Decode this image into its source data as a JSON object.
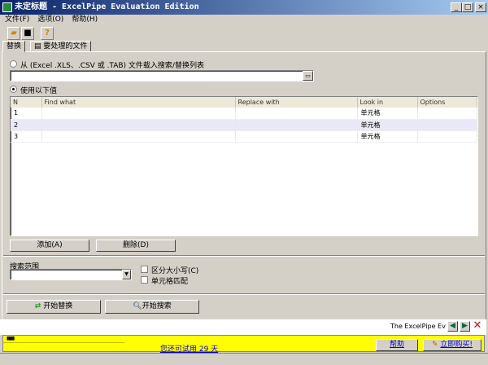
{
  "window": {
    "title": "未定标题 - ExcelPipe Evaluation Edition"
  },
  "menu": [
    "文件(F)",
    "选项(O)",
    "帮助(H)"
  ],
  "toolbar": {
    "icons": [
      "open-folder-icon",
      "save-icon",
      "help-icon"
    ]
  },
  "tabs": [
    {
      "label": "替换",
      "active": true
    },
    {
      "label": "要处理的文件",
      "active": false
    }
  ],
  "source": {
    "from_file_label": "从 (Excel .XLS、.CSV 或 .TAB) 文件载入搜索/替换列表",
    "file_value": "",
    "use_values_label": "使用以下值",
    "selected": "use_values"
  },
  "table": {
    "columns": [
      "N",
      "Find what",
      "Replace with",
      "Look in",
      "Options"
    ],
    "rows": [
      {
        "n": "1",
        "find": "",
        "replace": "",
        "lookin": "单元格",
        "options": ""
      },
      {
        "n": "2",
        "find": "",
        "replace": "",
        "lookin": "单元格",
        "options": ""
      },
      {
        "n": "3",
        "find": "",
        "replace": "",
        "lookin": "单元格",
        "options": ""
      }
    ],
    "selected_row": 2
  },
  "buttons": {
    "add": "添加(A)",
    "delete": "删除(D)",
    "start_replace": "开始替换",
    "start_search": "开始搜索"
  },
  "search_scope": {
    "label": "搜索范围",
    "value": "",
    "case_label": "区分大小写(C)",
    "cell_match_label": "单元格匹配",
    "case_checked": false,
    "cell_match_checked": false
  },
  "info": {
    "scroll_text": "The ExcelPipe Evalu"
  },
  "trial": {
    "days_text": "您还可试用 29 天",
    "help": "帮助",
    "buy": "立即购买!",
    "highlight": "#ffff00"
  }
}
